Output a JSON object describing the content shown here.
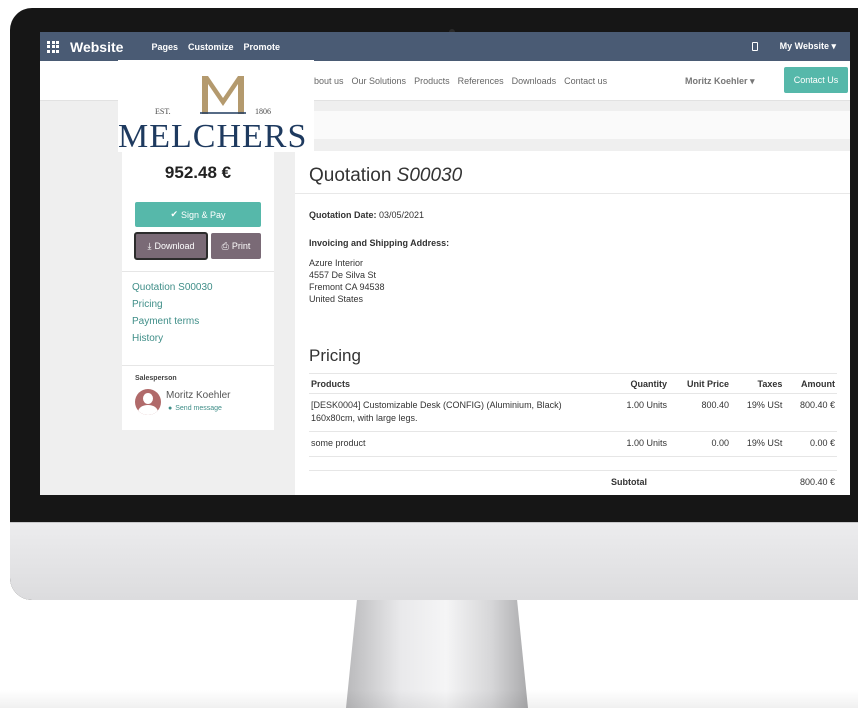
{
  "topbar": {
    "brand": "Website",
    "menu": [
      "Pages",
      "Customize",
      "Promote"
    ],
    "my_website": "My Website ▾"
  },
  "sitenav": {
    "links": [
      "bout us",
      "Our Solutions",
      "Products",
      "References",
      "Downloads",
      "Contact us"
    ],
    "user": "Moritz Koehler ▾",
    "contact_button": "Contact Us"
  },
  "logo": {
    "est": "EST.",
    "year": "1806",
    "wordmark": "MELCHERS"
  },
  "sidebar": {
    "amount": "952.48 €",
    "sign_pay": "Sign & Pay",
    "download": "Download",
    "print": "Print",
    "links": [
      "Quotation S00030",
      "Pricing",
      "Payment terms",
      "History"
    ],
    "salesperson_label": "Salesperson",
    "salesperson_name": "Moritz Koehler",
    "send_message": "Send message"
  },
  "quotation": {
    "title_prefix": "Quotation ",
    "number": "S00030",
    "date_label": "Quotation Date:",
    "date_value": "03/05/2021",
    "address_label": "Invoicing and Shipping Address:",
    "address_lines": [
      "Azure Interior",
      "4557 De Silva St",
      "Fremont CA 94538",
      "United States"
    ]
  },
  "pricing": {
    "title": "Pricing",
    "columns": [
      "Products",
      "Quantity",
      "Unit Price",
      "Taxes",
      "Amount"
    ],
    "rows": [
      {
        "product": "[DESK0004] Customizable Desk (CONFIG) (Aluminium, Black) 160x80cm, with large legs.",
        "quantity": "1.00 Units",
        "unit_price": "800.40",
        "taxes": "19% USt",
        "amount": "800.40 €"
      },
      {
        "product": "some product",
        "quantity": "1.00 Units",
        "unit_price": "0.00",
        "taxes": "19% USt",
        "amount": "0.00 €"
      }
    ],
    "subtotal_label": "Subtotal",
    "subtotal_value": "800.40 €"
  },
  "colors": {
    "topbar": "#4a5b74",
    "accent": "#56b8aa",
    "secondary_button": "#7a6a76",
    "logo_navy": "#1e3a5f",
    "logo_gold": "#b49a6e"
  }
}
